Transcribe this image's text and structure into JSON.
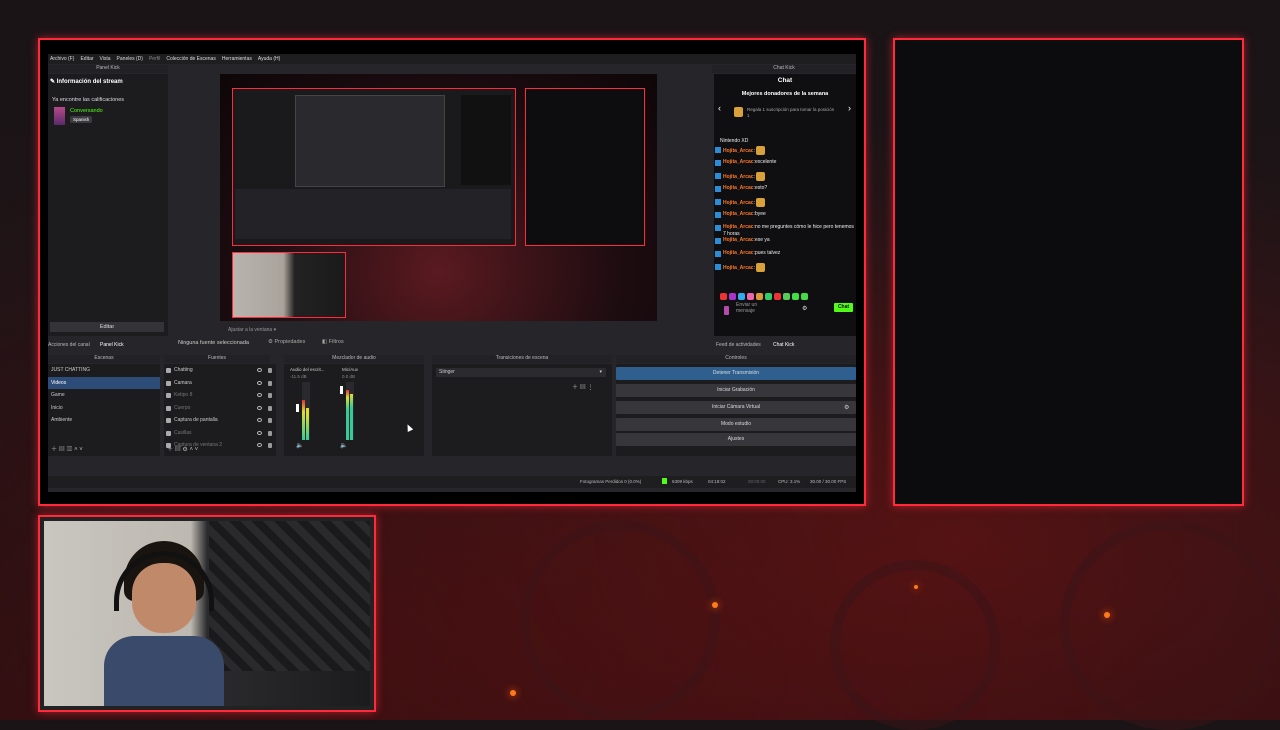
{
  "menubar": [
    "Archivo (F)",
    "Editar",
    "Vista",
    "Paneles (D)",
    "Perfil",
    "Colección de Escenas",
    "Herramientas",
    "Ayuda (H)"
  ],
  "panel_kick": {
    "title": "Panel Kick",
    "stream_info": "Información del stream",
    "ratings_note": "Ya encontre las calificaciones",
    "category": "Conversando",
    "language": "Spanish",
    "edit_button": "Editar",
    "tab_channel_events": "Acciones del canal",
    "tab_panel_kick": "Panel Kick"
  },
  "preview": {
    "bottom_left": "Ninguna fuente seleccionada",
    "properties": "Propiedades",
    "filters": "Filtros",
    "zoom_hint": "Ajustar a la ventana"
  },
  "chat": {
    "dock_title": "Chat Kick",
    "header": "Chat",
    "top_donors": "Mejores donadores de la semana",
    "gift_prompt": "Regala 1 suscripción para tomar la posición 1",
    "partial_line": "Nintendo XD",
    "messages": [
      {
        "user": "Hojita_Arcac",
        "text": ""
      },
      {
        "user": "Hojita_Arcac",
        "text": "excelente"
      },
      {
        "user": "Hojita_Arcac",
        "text": ""
      },
      {
        "user": "Hojita_Arcac",
        "text": "esto?"
      },
      {
        "user": "Hojita_Arcac",
        "text": ""
      },
      {
        "user": "Hojita_Arcac",
        "text": "byee"
      },
      {
        "user": "Hojita_Arcac",
        "text": "no me preguntes cómo le hice pero tenemos 7 horas"
      },
      {
        "user": "Hojita_Arcac",
        "text": "ese ya"
      },
      {
        "user": "Hojita_Arcac",
        "text": "pues talvez"
      },
      {
        "user": "Hojita_Arcac",
        "text": ""
      }
    ],
    "input_placeholder": "Enviar un mensaje",
    "send_button": "Chat",
    "tab_activity": "Feed de actividades",
    "tab_chat": "Chat Kick"
  },
  "docks": {
    "scenes": "Escenas",
    "sources": "Fuentes",
    "mixer": "Mezclador de audio",
    "transitions": "Transiciones de escena",
    "controls": "Controles"
  },
  "scenes": [
    "JUST CHATTING",
    "Videos",
    "Game",
    "Inicio",
    "Ambiente"
  ],
  "selected_scene_index": 1,
  "sources": [
    "Chatting",
    "Camara",
    "Ketipo 8",
    "Cuerpo",
    "Captura de pantalla",
    "Casillas",
    "Captura de ventana 2"
  ],
  "mixer": {
    "channel1": "Audio del escrit...",
    "channel1_db": "-11.5 dB",
    "channel2": "Mic/Aux",
    "channel2_db": "0.0 dB"
  },
  "transition": {
    "selected": "Stinger"
  },
  "controls": {
    "stop_stream": "Detener Transmisión",
    "start_recording": "Iniciar Grabación",
    "start_virtual_cam": "Iniciar Cámara Virtual",
    "studio_mode": "Modo estudio",
    "settings": "Ajustes"
  },
  "statusbar": {
    "dropped": "Fotogramas Perdidos 0 (0.0%)",
    "bitrate": "6309 kbps",
    "live_time": "04:18:02",
    "rec_time": "00:00:00",
    "cpu": "CPU: 3.1%",
    "fps": "30.00 / 30.00 FPS"
  },
  "colors": {
    "frame_border": "#ff2a3a",
    "accent_green": "#53fc18",
    "selection": "#2d4d78",
    "username": "#ff7a2a"
  }
}
